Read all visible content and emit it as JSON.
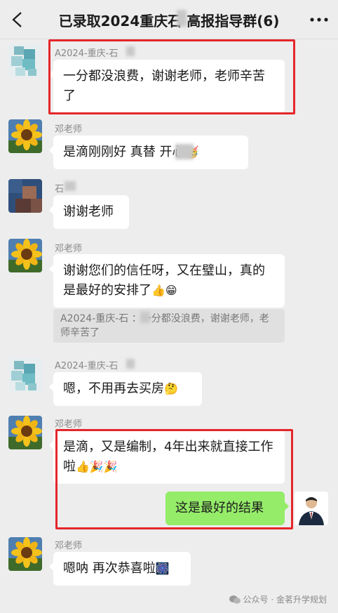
{
  "header": {
    "title": "已录取2024重庆石   高报指导群(6)"
  },
  "messages": [
    {
      "sender": "A2024-重庆-石",
      "text": "一分都没浪费，谢谢老师，老师辛苦了"
    },
    {
      "sender": "邓老师",
      "text": "是滴刚刚好 真替  开心"
    },
    {
      "sender": "石",
      "text": "谢谢老师"
    },
    {
      "sender": "邓老师",
      "text": "谢谢您们的信任呀，又在璧山，真的是最好的安排了",
      "quote": "A2024-重庆-石 ：一分都没浪费，谢谢老师，老师辛苦了"
    },
    {
      "sender": "A2024-重庆-石",
      "text": "嗯，不用再去买房"
    },
    {
      "sender": "邓老师",
      "text": "是滴，又是编制，4年出来就直接工作啦"
    },
    {
      "sender": "me",
      "text": "这是最好的结果"
    },
    {
      "sender": "邓老师",
      "text": "嗯呐 再次恭喜啦"
    }
  ],
  "emojis": {
    "party_face": "🥳",
    "thumbs_up": "👍",
    "grin": "😁",
    "thinking": "🤔",
    "party_popper": "🎉",
    "firework": "🎆"
  },
  "watermark": "公众号 · 金茗升学规划",
  "colors": {
    "background": "#ededed",
    "bubble_left": "#ffffff",
    "bubble_right": "#95ec69",
    "highlight": "#e5262a"
  }
}
